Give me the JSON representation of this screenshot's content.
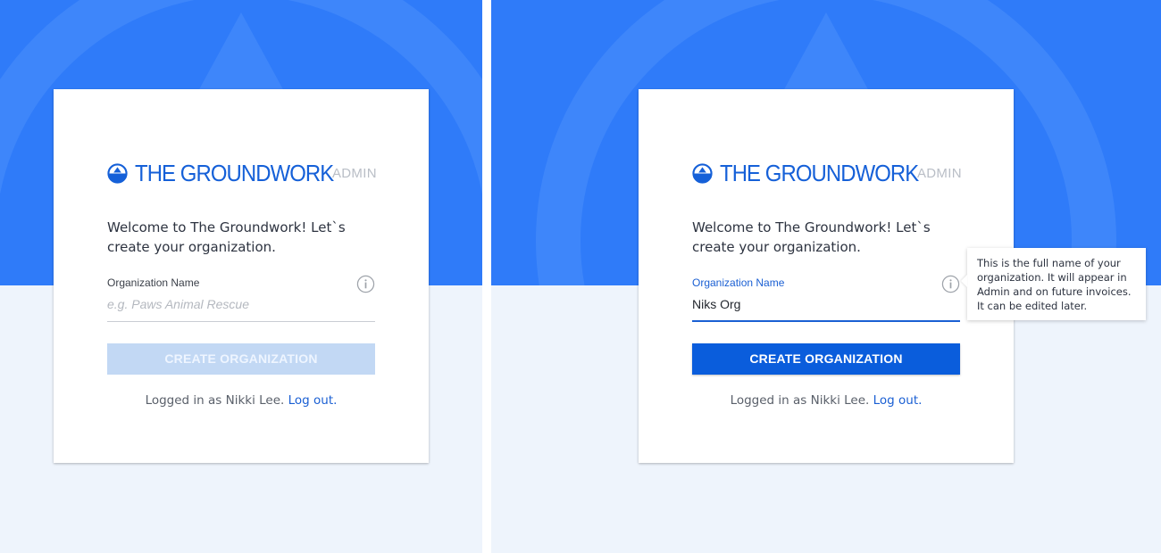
{
  "brand": {
    "name": "THE GROUNDWORK",
    "suffix": "ADMIN",
    "primary_color": "#1560d8",
    "hero_color": "#2f7bf9",
    "background_color": "#eef4fc"
  },
  "screens": [
    {
      "state": "empty",
      "welcome": "Welcome to The Groundwork! Let`s create your organization.",
      "field": {
        "label": "Organization Name",
        "placeholder": "e.g. Paws Animal Rescue",
        "value": "",
        "focused": false
      },
      "button": {
        "label": "CREATE ORGANIZATION",
        "enabled": false
      },
      "footer": {
        "text": "Logged in as Nikki Lee.",
        "link": "Log out."
      }
    },
    {
      "state": "filled",
      "welcome": "Welcome to The Groundwork! Let`s create your organization.",
      "field": {
        "label": "Organization Name",
        "placeholder": "e.g. Paws Animal Rescue",
        "value": "Niks Org",
        "focused": true
      },
      "button": {
        "label": "CREATE ORGANIZATION",
        "enabled": true
      },
      "footer": {
        "text": "Logged in as Nikki Lee.",
        "link": "Log out."
      },
      "tooltip": "This is the full name of your organization. It will appear in Admin and on future invoices. It can be edited later."
    }
  ]
}
